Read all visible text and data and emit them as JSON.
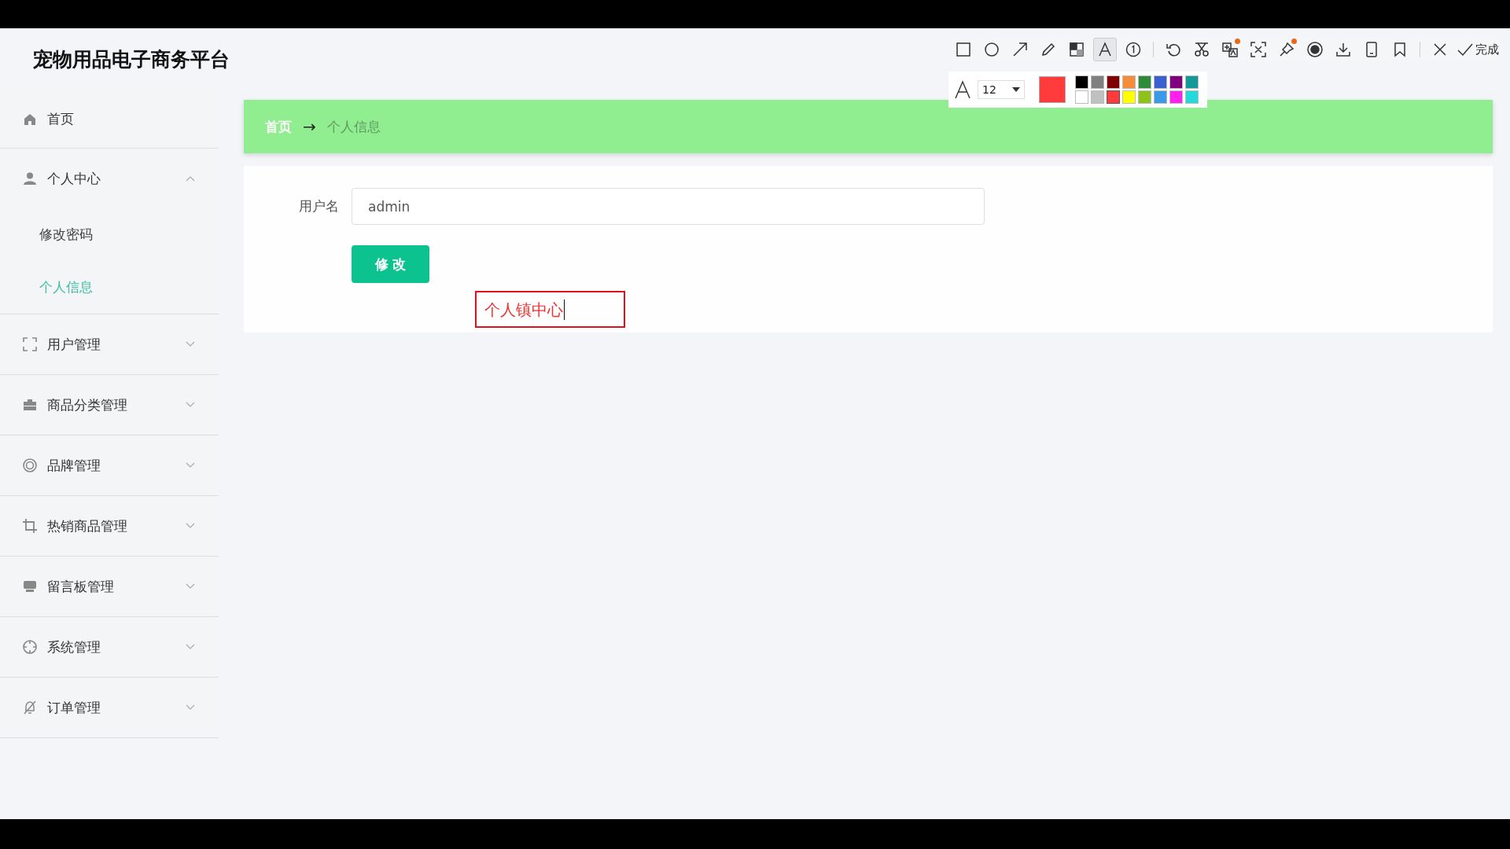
{
  "header": {
    "title": "宠物用品电子商务平台"
  },
  "sidebar": {
    "items": [
      {
        "label": "首页"
      },
      {
        "label": "个人中心",
        "expanded": true,
        "children": [
          {
            "label": "修改密码",
            "selected": false
          },
          {
            "label": "个人信息",
            "selected": true
          }
        ]
      },
      {
        "label": "用户管理",
        "expanded": false
      },
      {
        "label": "商品分类管理",
        "expanded": false
      },
      {
        "label": "品牌管理",
        "expanded": false
      },
      {
        "label": "热销商品管理",
        "expanded": false
      },
      {
        "label": "留言板管理",
        "expanded": false
      },
      {
        "label": "系统管理",
        "expanded": false
      },
      {
        "label": "订单管理",
        "expanded": false
      }
    ]
  },
  "breadcrumb": {
    "items": [
      "首页",
      "个人信息"
    ],
    "separator": "→"
  },
  "form": {
    "fields": [
      {
        "label": "用户名",
        "value": "admin"
      }
    ],
    "button": "修 改"
  },
  "annotation": {
    "text": "个人镇中心"
  },
  "capture_toolbar": {
    "tools": [
      {
        "selected": false,
        "badge": false
      },
      {
        "selected": false,
        "badge": false
      },
      {
        "selected": false,
        "badge": false
      },
      {
        "selected": false,
        "badge": false
      },
      {
        "selected": false,
        "badge": false
      },
      {
        "selected": true,
        "badge": false
      },
      {
        "selected": false,
        "badge": false
      },
      {
        "selected": false,
        "badge": false
      },
      {
        "selected": false,
        "badge": false
      },
      {
        "selected": false,
        "badge": true
      },
      {
        "selected": false,
        "badge": false
      },
      {
        "selected": false,
        "badge": true
      },
      {
        "selected": false,
        "badge": false
      },
      {
        "selected": false,
        "badge": false
      },
      {
        "selected": false,
        "badge": false
      },
      {
        "selected": false,
        "badge": false
      }
    ],
    "done_label": "完成",
    "font_size": "12",
    "palette": [
      {
        "color": "#000000",
        "selected": false
      },
      {
        "color": "#808080",
        "selected": false
      },
      {
        "color": "#800000",
        "selected": false
      },
      {
        "color": "#f58c3c",
        "selected": false
      },
      {
        "color": "#2e8b3a",
        "selected": false
      },
      {
        "color": "#3a5fd0",
        "selected": false
      },
      {
        "color": "#800080",
        "selected": false
      },
      {
        "color": "#11999a",
        "selected": false
      },
      {
        "color": "#ffffff",
        "selected": false
      },
      {
        "color": "#c0c0c0",
        "selected": false
      },
      {
        "color": "#ff3b3b",
        "selected": true
      },
      {
        "color": "#ffff00",
        "selected": false
      },
      {
        "color": "#8ec21b",
        "selected": false
      },
      {
        "color": "#3b9ae8",
        "selected": false
      },
      {
        "color": "#ff20f0",
        "selected": false
      },
      {
        "color": "#22dada",
        "selected": false
      }
    ]
  }
}
